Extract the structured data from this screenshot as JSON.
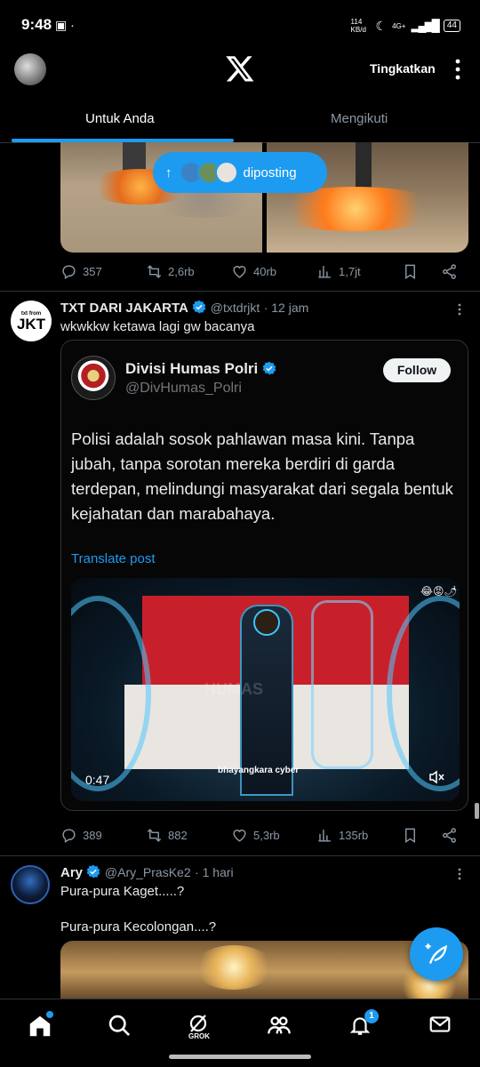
{
  "status_bar": {
    "time": "9:48",
    "net_speed": "114 KB/d",
    "network": "4G+",
    "battery": "44"
  },
  "header": {
    "upgrade_label": "Tingkatkan"
  },
  "tabs": [
    {
      "label": "Untuk Anda",
      "active": true
    },
    {
      "label": "Mengikuti",
      "active": false
    }
  ],
  "new_posts_pill": {
    "label": "diposting"
  },
  "tweet1": {
    "replies": "357",
    "retweets": "2,6rb",
    "likes": "40rb",
    "views": "1,7jt"
  },
  "tweet2": {
    "avatar_text": "JKT",
    "avatar_subtext": "txt from",
    "name": "TXT DARI JAKARTA",
    "handle": "@txtdrjkt",
    "time": "· 12 jam",
    "text": "wkwkkw ketawa lagi gw bacanya",
    "quote": {
      "name": "Divisi Humas Polri",
      "handle": "@DivHumas_Polri",
      "follow_label": "Follow",
      "body": "Polisi adalah sosok pahlawan masa kini. Tanpa jubah, tanpa sorotan mereka berdiri di garda terdepan, melindungi masyarakat dari segala bentuk kejahatan dan marabahaya.",
      "translate_label": "Translate post",
      "video_duration": "0:47",
      "video_caption": "bhayangkara cyber",
      "video_watermark": "HUMAS"
    },
    "replies": "389",
    "retweets": "882",
    "likes": "5,3rb",
    "views": "135rb"
  },
  "tweet3": {
    "name": "Ary",
    "handle": "@Ary_PrasKe2",
    "time": "· 1 hari",
    "line1": "Pura-pura Kaget.....?",
    "line2": "Pura-pura Kecolongan....?"
  },
  "bottom_nav": {
    "grok_label": "GROK",
    "notification_count": "1"
  },
  "colors": {
    "accent": "#1d9bf0",
    "background": "#000000",
    "text": "#e7e9ea",
    "muted": "#8b98a5",
    "border": "#2f3336"
  }
}
